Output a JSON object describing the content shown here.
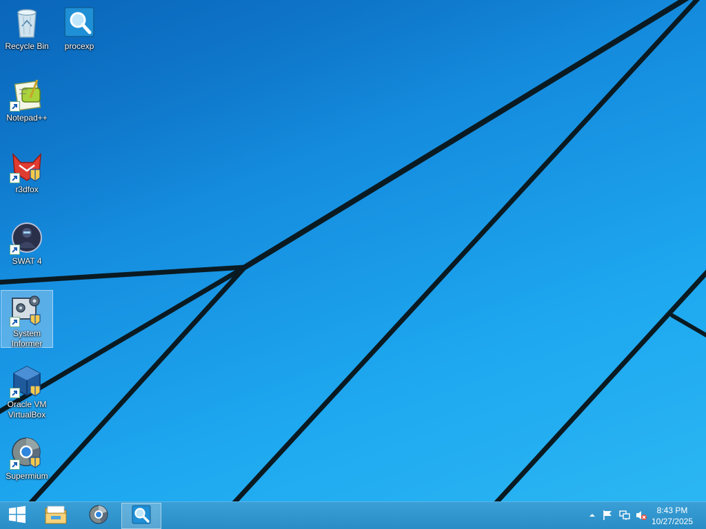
{
  "desktop": {
    "icons": [
      {
        "label": "Recycle Bin",
        "icon": "recycle-bin-icon"
      },
      {
        "label": "procexp",
        "icon": "procexp-icon"
      },
      {
        "label": "Notepad++",
        "icon": "notepad-plus-plus-icon"
      },
      {
        "label": "r3dfox",
        "icon": "r3dfox-icon"
      },
      {
        "label": "SWAT 4",
        "icon": "swat4-icon"
      },
      {
        "label": "System Informer",
        "icon": "system-informer-icon",
        "selected": true
      },
      {
        "label": "Oracle VM VirtualBox",
        "icon": "virtualbox-icon"
      },
      {
        "label": "Supermium",
        "icon": "supermium-icon"
      }
    ]
  },
  "taskbar": {
    "start": "windows-logo-icon",
    "pinned": [
      "file-explorer-icon",
      "supermium-icon",
      "procexp-icon"
    ],
    "active": "procexp-icon",
    "tray": [
      "show-hidden-icons",
      "action-center-flag-icon",
      "network-icon",
      "volume-muted-icon"
    ]
  },
  "clock": {
    "time": "8:43 PM",
    "date": "10/27/2025"
  },
  "colors": {
    "wallpaper": "#1a9be8",
    "taskbar": "#2f95cd",
    "text": "#ffffff"
  }
}
